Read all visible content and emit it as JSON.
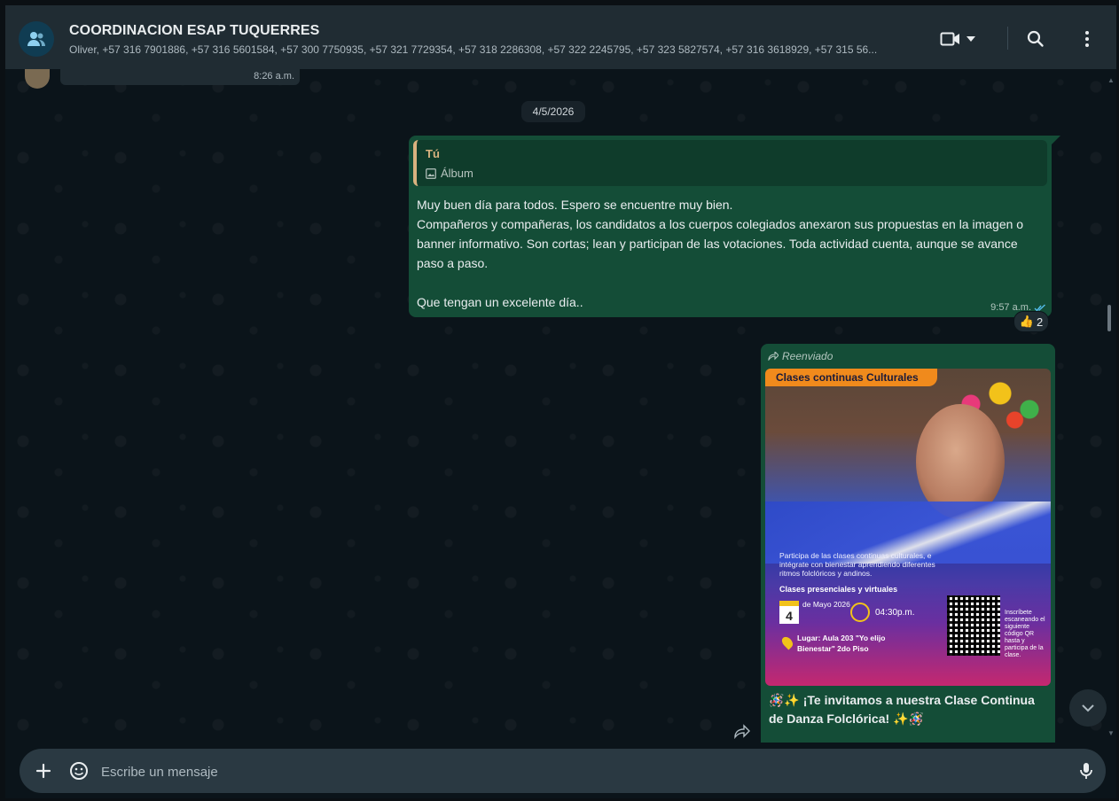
{
  "header": {
    "title": "COORDINACION ESAP TUQUERRES",
    "members": "Oliver, +57 316 7901886, +57 316 5601584, +57 300 7750935, +57 321 7729354, +57 318 2286308, +57 322 2245795, +57 323 5827574, +57 316 3618929, +57 315 56..."
  },
  "previous_message": {
    "time": "8:26 a.m."
  },
  "date_chip": "4/5/2026",
  "message_1": {
    "quote_author": "Tú",
    "quote_type": "Álbum",
    "text": "Muy buen día para todos. Espero se encuentre muy bien.\nCompañeros y compañeras, los candidatos a los cuerpos colegiados anexaron sus propuestas en la imagen o banner informativo. Son cortas; lean y participan de las votaciones. Toda actividad cuenta, aunque se avance paso a paso.\n\nQue tengan un excelente día..",
    "time": "9:57 a.m.",
    "reaction": {
      "emoji": "👍",
      "count": "2"
    }
  },
  "message_2": {
    "forward_label": "Reenviado",
    "poster": {
      "banner": "Clases continuas Culturales",
      "description": "Participa de las clases continuas culturales, e intégrate con bienestar aprendiendo diferentes ritmos folclóricos y andinos.",
      "mode": "Clases presenciales y virtuales",
      "day": "4",
      "date_label": "de Mayo 2026",
      "time": "04:30p.m.",
      "place": "Lugar: Aula 203 \"Yo elijo Bienestar\" 2do Piso",
      "qr_text": "Inscríbete escaneando el siguiente código QR hasta y participa de la clase."
    },
    "caption": "🪅✨ ¡Te invitamos a nuestra Clase Continua de Danza Folclórica! ✨🪅"
  },
  "composer": {
    "placeholder": "Escribe un mensaje"
  },
  "colors": {
    "header_bg": "#202c33",
    "chat_bg": "#0b141a",
    "outgoing_bubble": "#144d37",
    "accent": "#53bdeb"
  }
}
